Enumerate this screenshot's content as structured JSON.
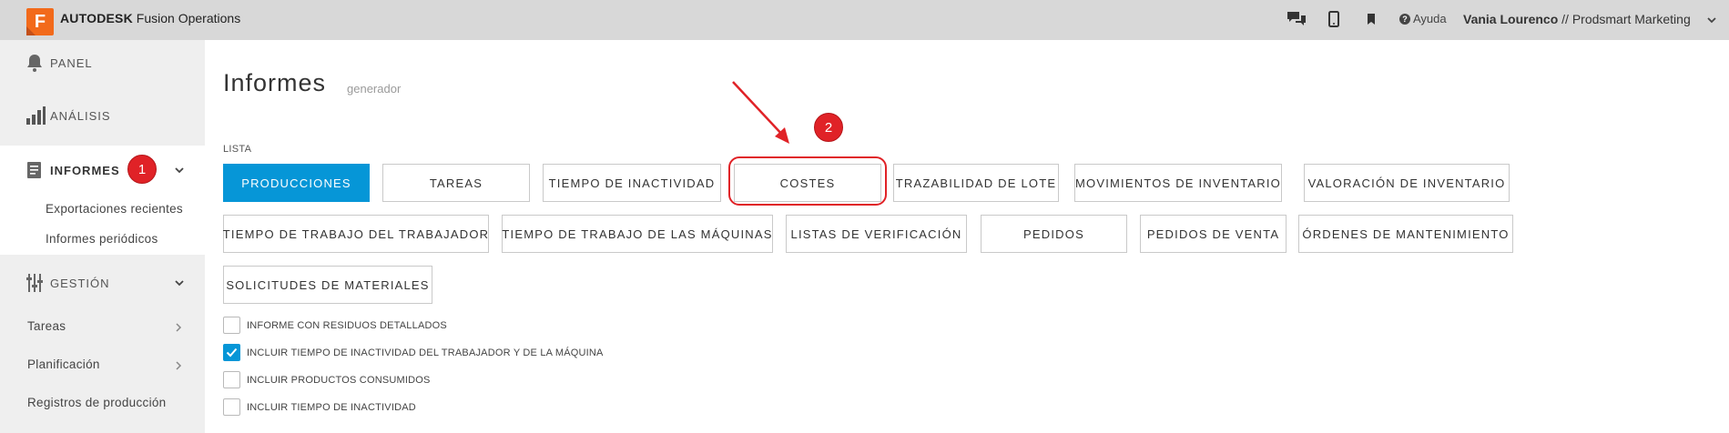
{
  "header": {
    "logo_letter": "F",
    "brand_bold": "AUTODESK",
    "brand_rest": "Fusion Operations",
    "help_label": "Ayuda",
    "user_name": "Vania Lourenco",
    "user_sep": "//",
    "user_company": "Prodsmart Marketing",
    "icons": [
      "chat-icon",
      "mobile-icon",
      "bookmark-icon",
      "help-icon",
      "chevron-down-icon"
    ]
  },
  "sidebar": {
    "panel": "PANEL",
    "analisis": "ANÁLISIS",
    "informes": "INFORMES",
    "informes_sub": [
      "Exportaciones recientes",
      "Informes periódicos"
    ],
    "gestion": "GESTIÓN",
    "tareas": "Tareas",
    "planificacion": "Planificación",
    "registros": "Registros de producción"
  },
  "annotations": {
    "badge1": "1",
    "badge2": "2",
    "accent": "#e02227"
  },
  "main": {
    "title": "Informes",
    "subtitle": "generador",
    "list_label": "LISTA",
    "report_buttons": [
      "PRODUCCIONES",
      "TAREAS",
      "TIEMPO DE INACTIVIDAD",
      "COSTES",
      "TRAZABILIDAD DE LOTE",
      "MOVIMIENTOS DE INVENTARIO",
      "VALORACIÓN DE INVENTARIO",
      "TIEMPO DE TRABAJO DEL TRABAJADOR",
      "TIEMPO DE TRABAJO DE LAS MÁQUINAS",
      "LISTAS DE VERIFICACIÓN",
      "PEDIDOS",
      "PEDIDOS DE VENTA",
      "ÓRDENES DE MANTENIMIENTO",
      "SOLICITUDES DE MATERIALES"
    ],
    "active_button": "PRODUCCIONES",
    "options": [
      {
        "label": "INFORME CON RESIDUOS DETALLADOS",
        "checked": false
      },
      {
        "label": "INCLUIR TIEMPO DE INACTIVIDAD DEL TRABAJADOR Y DE LA MÁQUINA",
        "checked": true
      },
      {
        "label": "INCLUIR PRODUCTOS CONSUMIDOS",
        "checked": false
      },
      {
        "label": "INCLUIR TIEMPO DE INACTIVIDAD",
        "checked": false
      }
    ]
  },
  "colors": {
    "primary": "#0696d7",
    "logo_orange": "#f26a1b",
    "topbar": "#d8d8d8",
    "sidebar": "#efefef"
  }
}
